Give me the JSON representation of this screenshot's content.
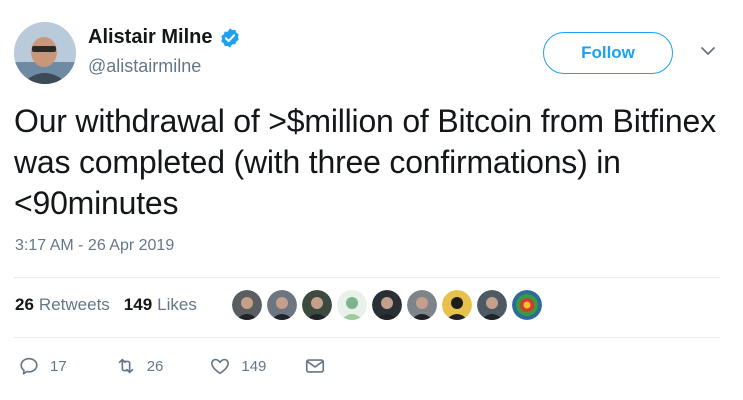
{
  "user": {
    "display_name": "Alistair Milne",
    "handle": "@alistairmilne",
    "verified_icon": "verified-badge-icon"
  },
  "follow_button_label": "Follow",
  "tweet": {
    "text": "Our withdrawal of >$million of Bitcoin from Bitfinex was completed (with three confirmations) in <90minutes",
    "timestamp": "3:17 AM - 26 Apr 2019"
  },
  "stats": {
    "retweets_count": "26",
    "retweets_label": "Retweets",
    "likes_count": "149",
    "likes_label": "Likes"
  },
  "likers": [
    {
      "icon": "liker-avatar-1",
      "color": "#5a5d61"
    },
    {
      "icon": "liker-avatar-2",
      "color": "#6b7680"
    },
    {
      "icon": "liker-avatar-3",
      "color": "#3c4a3f"
    },
    {
      "icon": "liker-avatar-4",
      "color": "#e9f2ea"
    },
    {
      "icon": "liker-avatar-5",
      "color": "#2b3036"
    },
    {
      "icon": "liker-avatar-6",
      "color": "#7e8489"
    },
    {
      "icon": "liker-avatar-7",
      "color": "#e8c14c"
    },
    {
      "icon": "liker-avatar-8",
      "color": "#4d5a63"
    },
    {
      "icon": "liker-avatar-9",
      "color": "#2e6b9a"
    }
  ],
  "actions": {
    "reply_count": "17",
    "retweet_count": "26",
    "like_count": "149"
  },
  "colors": {
    "accent": "#1da1f2",
    "secondary_text": "#657786",
    "divider": "#e6ecf0"
  }
}
